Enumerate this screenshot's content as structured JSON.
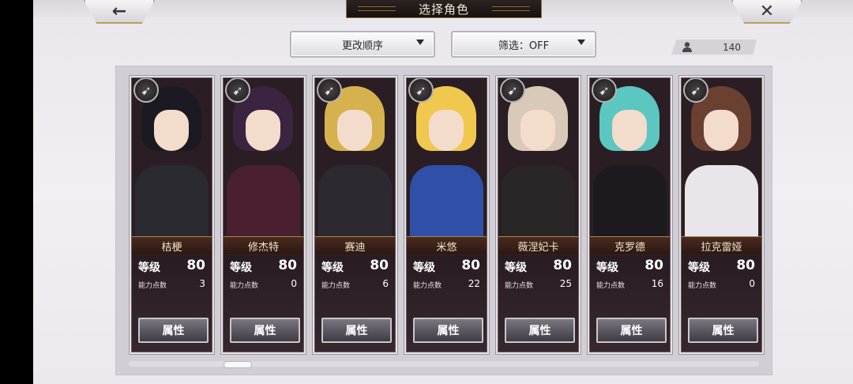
{
  "header": {
    "back_icon": "←",
    "title": "选择角色",
    "close_icon": "✕"
  },
  "controls": {
    "sort_label": "更改顺序",
    "filter_label": "筛选：OFF",
    "character_count": "140"
  },
  "characters": [
    {
      "name": "桔梗",
      "level_label": "等级",
      "level": "80",
      "ap_label": "能力点数",
      "ap": "3",
      "button": "属性",
      "hair": "#1b1a22",
      "body": "#2a2a30"
    },
    {
      "name": "修杰特",
      "level_label": "等级",
      "level": "80",
      "ap_label": "能力点数",
      "ap": "0",
      "button": "属性",
      "hair": "#3b2440",
      "body": "#4a2030"
    },
    {
      "name": "赛迪",
      "level_label": "等级",
      "level": "80",
      "ap_label": "能力点数",
      "ap": "6",
      "button": "属性",
      "hair": "#d6b24e",
      "body": "#2c2a30"
    },
    {
      "name": "米悠",
      "level_label": "等级",
      "level": "80",
      "ap_label": "能力点数",
      "ap": "22",
      "button": "属性",
      "hair": "#f0c84e",
      "body": "#3050a8"
    },
    {
      "name": "薇涅妃卡",
      "level_label": "等级",
      "level": "80",
      "ap_label": "能力点数",
      "ap": "25",
      "button": "属性",
      "hair": "#d9c9b8",
      "body": "#2a2628"
    },
    {
      "name": "克罗德",
      "level_label": "等级",
      "level": "80",
      "ap_label": "能力点数",
      "ap": "16",
      "button": "属性",
      "hair": "#5cc6c0",
      "body": "#1c1a1e"
    },
    {
      "name": "拉克雷娅",
      "level_label": "等级",
      "level": "80",
      "ap_label": "能力点数",
      "ap": "0",
      "button": "属性",
      "hair": "#6a4030",
      "body": "#e8e6ea"
    }
  ]
}
